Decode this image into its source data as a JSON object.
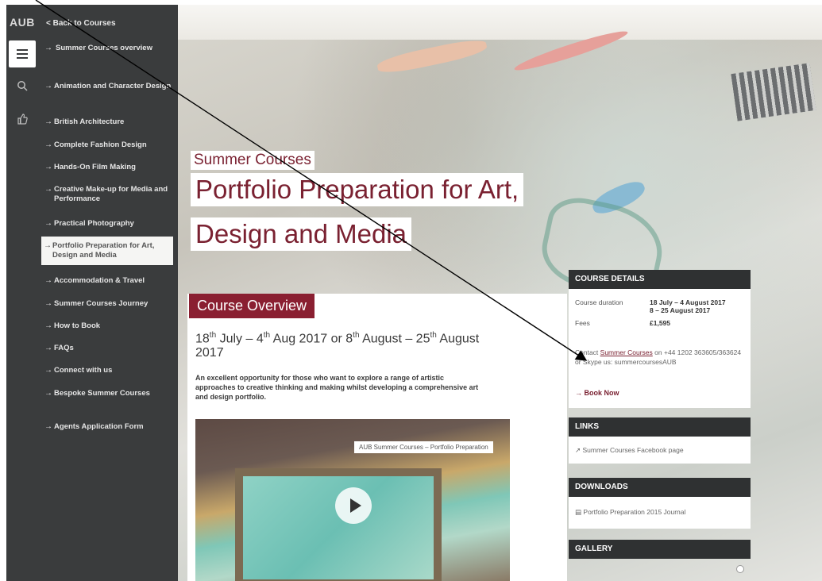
{
  "sidebar": {
    "logo": "AUB",
    "back_label": "Back to Courses",
    "items": [
      {
        "label": "Summer Courses overview"
      },
      {
        "label": "Animation and Character Design"
      },
      {
        "label": "British Architecture"
      },
      {
        "label": "Complete Fashion Design"
      },
      {
        "label": "Hands-On Film Making"
      },
      {
        "label": "Creative Make-up for Media and Performance"
      },
      {
        "label": "Practical Photography"
      },
      {
        "label": "Portfolio Preparation for Art, Design and Media"
      },
      {
        "label": "Accommodation & Travel"
      },
      {
        "label": "Summer Courses Journey"
      },
      {
        "label": "How to Book"
      },
      {
        "label": "FAQs"
      },
      {
        "label": "Connect with us"
      },
      {
        "label": "Bespoke Summer Courses"
      },
      {
        "label": "Agents Application Form"
      }
    ],
    "icons": [
      "menu-icon",
      "search-icon",
      "thumbs-up-icon"
    ]
  },
  "hero": {
    "subtitle": "Summer Courses",
    "title_line1": "Portfolio Preparation for Art,",
    "title_line2": "Design and Media"
  },
  "overview": {
    "tag": "Course Overview",
    "dates_part1": "18",
    "dates_sup1": "th",
    "dates_part2": " July – 4",
    "dates_sup2": "th",
    "dates_part3": " Aug 2017 or 8",
    "dates_sup3": "th",
    "dates_part4": " August – 25",
    "dates_sup4": "th",
    "dates_part5": " August 2017",
    "intro": "An excellent opportunity for those who want to explore a range of artistic approaches to creative thinking and making whilst developing a comprehensive art and design portfolio.",
    "video_caption": "AUB Summer Courses – Portfolio Preparation"
  },
  "course_details": {
    "heading": "COURSE DETAILS",
    "duration_label": "Course duration",
    "duration_value1": "18 July – 4 August 2017",
    "duration_value2": "8 – 25 August 2017",
    "fees_label": "Fees",
    "fees_value": "£1,595",
    "contact_prefix": "Contact ",
    "contact_link": "Summer Courses",
    "contact_suffix": " on +44 1202 363605/363624 or Skype us: summercoursesAUB",
    "book_label": "Book Now"
  },
  "links": {
    "heading": "LINKS",
    "item": "Summer Courses Facebook page"
  },
  "downloads": {
    "heading": "DOWNLOADS",
    "item": "Portfolio Preparation 2015 Journal"
  },
  "gallery": {
    "heading": "GALLERY"
  },
  "colors": {
    "sidebar_bg": "#3a3c3d",
    "brand": "#7a2131",
    "overview_tag": "#8a1f31",
    "panel_head": "#2f3132"
  }
}
